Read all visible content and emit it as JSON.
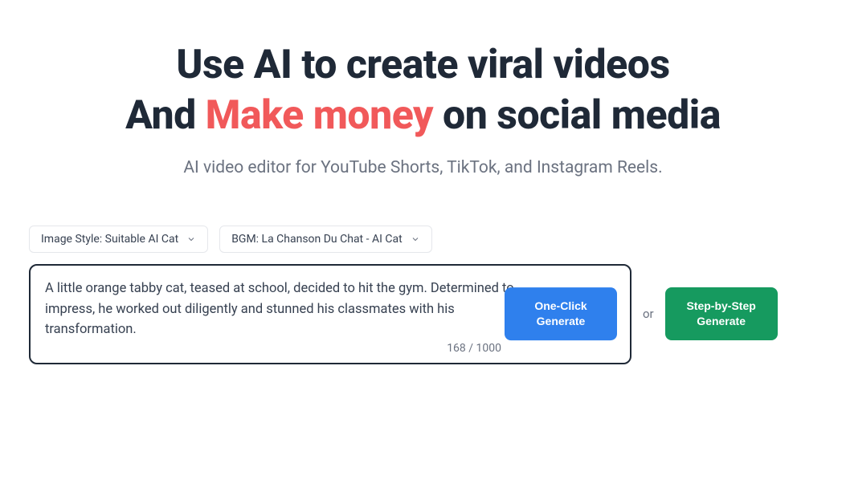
{
  "headline": {
    "line1": "Use AI to create viral videos",
    "line2_prefix": "And ",
    "line2_highlight": "Make money",
    "line2_suffix": " on social media"
  },
  "subtitle": "AI video editor for YouTube Shorts, TikTok, and Instagram Reels.",
  "dropdowns": {
    "image_style": "Image Style: Suitable AI Cat",
    "bgm": "BGM: La Chanson Du Chat - AI Cat"
  },
  "prompt": {
    "value": "A little orange tabby cat, teased at school, decided to hit the gym. Determined to impress, he worked out diligently and stunned his classmates with his transformation.",
    "char_count": "168 / 1000"
  },
  "buttons": {
    "one_click": "One-Click Generate",
    "or": "or",
    "step_by_step": "Step-by-Step Generate"
  }
}
